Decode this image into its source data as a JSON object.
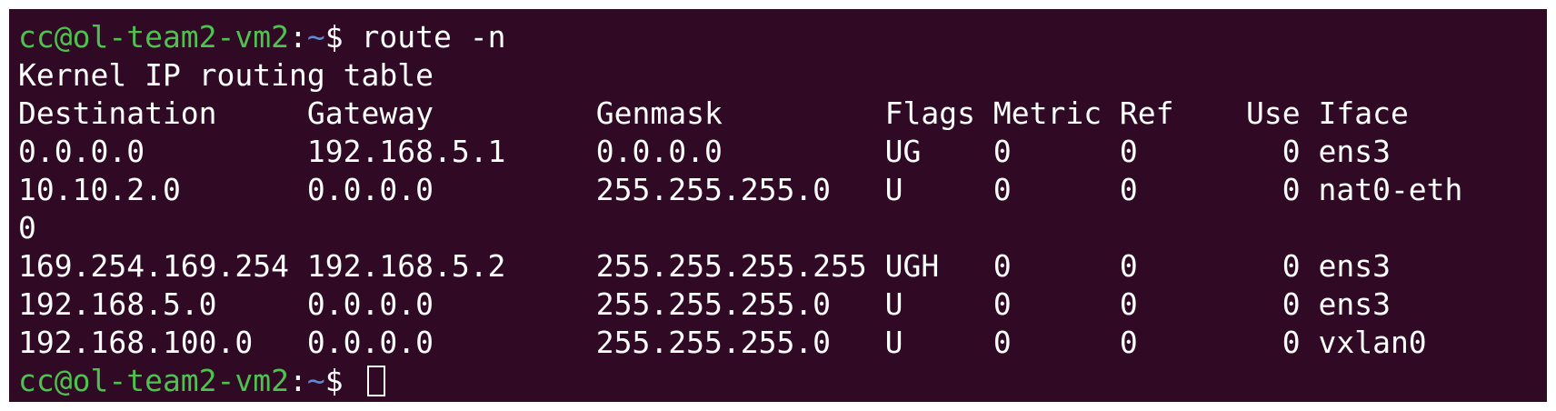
{
  "colors": {
    "background": "#300a24",
    "prompt_user_host": "#4ec24e",
    "prompt_path": "#5c8bd6",
    "text": "#ffffff"
  },
  "prompt": {
    "user_host": "cc@ol-team2-vm2",
    "colon": ":",
    "path": "~",
    "sigil": "$ "
  },
  "command": "route -n",
  "output": {
    "title": "Kernel IP routing table",
    "header": "Destination     Gateway         Genmask         Flags Metric Ref    Use Iface",
    "rows": [
      "0.0.0.0         192.168.5.1     0.0.0.0         UG    0      0        0 ens3",
      "10.10.2.0       0.0.0.0         255.255.255.0   U     0      0        0 nat0-eth",
      "0",
      "169.254.169.254 192.168.5.2     255.255.255.255 UGH   0      0        0 ens3",
      "192.168.5.0     0.0.0.0         255.255.255.0   U     0      0        0 ens3",
      "192.168.100.0   0.0.0.0         255.255.255.0   U     0      0        0 vxlan0"
    ]
  }
}
